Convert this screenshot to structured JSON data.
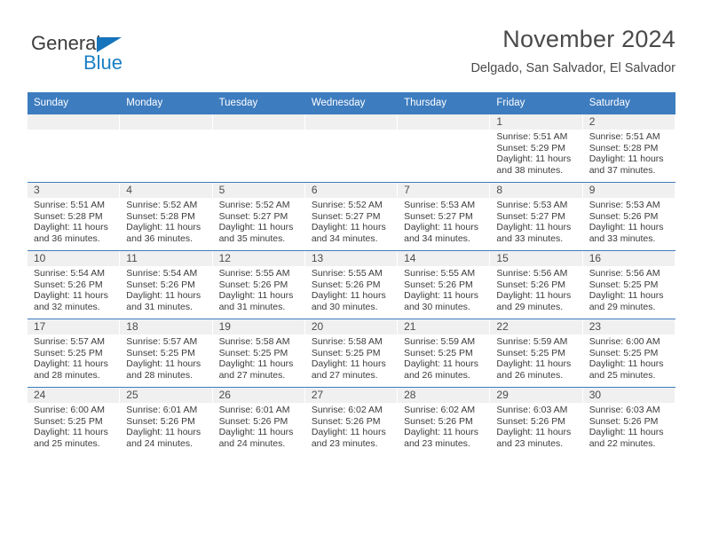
{
  "logo": {
    "word_top": "General",
    "word_bottom": "Blue",
    "triangle_color": "#1574bb",
    "blue_color": "#1b7fc4"
  },
  "header": {
    "title": "November 2024",
    "subtitle": "Delgado, San Salvador, El Salvador"
  },
  "theme": {
    "header_row_bg": "#3d7cbf",
    "cell_band_bg": "#f0f0f0",
    "text_color": "#3c3c3c"
  },
  "weekday_headers": [
    "Sunday",
    "Monday",
    "Tuesday",
    "Wednesday",
    "Thursday",
    "Friday",
    "Saturday"
  ],
  "weeks": [
    [
      {
        "day": "",
        "sunrise": "",
        "sunset": "",
        "daylight_1": "",
        "daylight_2": ""
      },
      {
        "day": "",
        "sunrise": "",
        "sunset": "",
        "daylight_1": "",
        "daylight_2": ""
      },
      {
        "day": "",
        "sunrise": "",
        "sunset": "",
        "daylight_1": "",
        "daylight_2": ""
      },
      {
        "day": "",
        "sunrise": "",
        "sunset": "",
        "daylight_1": "",
        "daylight_2": ""
      },
      {
        "day": "",
        "sunrise": "",
        "sunset": "",
        "daylight_1": "",
        "daylight_2": ""
      },
      {
        "day": "1",
        "sunrise": "Sunrise: 5:51 AM",
        "sunset": "Sunset: 5:29 PM",
        "daylight_1": "Daylight: 11 hours",
        "daylight_2": "and 38 minutes."
      },
      {
        "day": "2",
        "sunrise": "Sunrise: 5:51 AM",
        "sunset": "Sunset: 5:28 PM",
        "daylight_1": "Daylight: 11 hours",
        "daylight_2": "and 37 minutes."
      }
    ],
    [
      {
        "day": "3",
        "sunrise": "Sunrise: 5:51 AM",
        "sunset": "Sunset: 5:28 PM",
        "daylight_1": "Daylight: 11 hours",
        "daylight_2": "and 36 minutes."
      },
      {
        "day": "4",
        "sunrise": "Sunrise: 5:52 AM",
        "sunset": "Sunset: 5:28 PM",
        "daylight_1": "Daylight: 11 hours",
        "daylight_2": "and 36 minutes."
      },
      {
        "day": "5",
        "sunrise": "Sunrise: 5:52 AM",
        "sunset": "Sunset: 5:27 PM",
        "daylight_1": "Daylight: 11 hours",
        "daylight_2": "and 35 minutes."
      },
      {
        "day": "6",
        "sunrise": "Sunrise: 5:52 AM",
        "sunset": "Sunset: 5:27 PM",
        "daylight_1": "Daylight: 11 hours",
        "daylight_2": "and 34 minutes."
      },
      {
        "day": "7",
        "sunrise": "Sunrise: 5:53 AM",
        "sunset": "Sunset: 5:27 PM",
        "daylight_1": "Daylight: 11 hours",
        "daylight_2": "and 34 minutes."
      },
      {
        "day": "8",
        "sunrise": "Sunrise: 5:53 AM",
        "sunset": "Sunset: 5:27 PM",
        "daylight_1": "Daylight: 11 hours",
        "daylight_2": "and 33 minutes."
      },
      {
        "day": "9",
        "sunrise": "Sunrise: 5:53 AM",
        "sunset": "Sunset: 5:26 PM",
        "daylight_1": "Daylight: 11 hours",
        "daylight_2": "and 33 minutes."
      }
    ],
    [
      {
        "day": "10",
        "sunrise": "Sunrise: 5:54 AM",
        "sunset": "Sunset: 5:26 PM",
        "daylight_1": "Daylight: 11 hours",
        "daylight_2": "and 32 minutes."
      },
      {
        "day": "11",
        "sunrise": "Sunrise: 5:54 AM",
        "sunset": "Sunset: 5:26 PM",
        "daylight_1": "Daylight: 11 hours",
        "daylight_2": "and 31 minutes."
      },
      {
        "day": "12",
        "sunrise": "Sunrise: 5:55 AM",
        "sunset": "Sunset: 5:26 PM",
        "daylight_1": "Daylight: 11 hours",
        "daylight_2": "and 31 minutes."
      },
      {
        "day": "13",
        "sunrise": "Sunrise: 5:55 AM",
        "sunset": "Sunset: 5:26 PM",
        "daylight_1": "Daylight: 11 hours",
        "daylight_2": "and 30 minutes."
      },
      {
        "day": "14",
        "sunrise": "Sunrise: 5:55 AM",
        "sunset": "Sunset: 5:26 PM",
        "daylight_1": "Daylight: 11 hours",
        "daylight_2": "and 30 minutes."
      },
      {
        "day": "15",
        "sunrise": "Sunrise: 5:56 AM",
        "sunset": "Sunset: 5:26 PM",
        "daylight_1": "Daylight: 11 hours",
        "daylight_2": "and 29 minutes."
      },
      {
        "day": "16",
        "sunrise": "Sunrise: 5:56 AM",
        "sunset": "Sunset: 5:25 PM",
        "daylight_1": "Daylight: 11 hours",
        "daylight_2": "and 29 minutes."
      }
    ],
    [
      {
        "day": "17",
        "sunrise": "Sunrise: 5:57 AM",
        "sunset": "Sunset: 5:25 PM",
        "daylight_1": "Daylight: 11 hours",
        "daylight_2": "and 28 minutes."
      },
      {
        "day": "18",
        "sunrise": "Sunrise: 5:57 AM",
        "sunset": "Sunset: 5:25 PM",
        "daylight_1": "Daylight: 11 hours",
        "daylight_2": "and 28 minutes."
      },
      {
        "day": "19",
        "sunrise": "Sunrise: 5:58 AM",
        "sunset": "Sunset: 5:25 PM",
        "daylight_1": "Daylight: 11 hours",
        "daylight_2": "and 27 minutes."
      },
      {
        "day": "20",
        "sunrise": "Sunrise: 5:58 AM",
        "sunset": "Sunset: 5:25 PM",
        "daylight_1": "Daylight: 11 hours",
        "daylight_2": "and 27 minutes."
      },
      {
        "day": "21",
        "sunrise": "Sunrise: 5:59 AM",
        "sunset": "Sunset: 5:25 PM",
        "daylight_1": "Daylight: 11 hours",
        "daylight_2": "and 26 minutes."
      },
      {
        "day": "22",
        "sunrise": "Sunrise: 5:59 AM",
        "sunset": "Sunset: 5:25 PM",
        "daylight_1": "Daylight: 11 hours",
        "daylight_2": "and 26 minutes."
      },
      {
        "day": "23",
        "sunrise": "Sunrise: 6:00 AM",
        "sunset": "Sunset: 5:25 PM",
        "daylight_1": "Daylight: 11 hours",
        "daylight_2": "and 25 minutes."
      }
    ],
    [
      {
        "day": "24",
        "sunrise": "Sunrise: 6:00 AM",
        "sunset": "Sunset: 5:25 PM",
        "daylight_1": "Daylight: 11 hours",
        "daylight_2": "and 25 minutes."
      },
      {
        "day": "25",
        "sunrise": "Sunrise: 6:01 AM",
        "sunset": "Sunset: 5:26 PM",
        "daylight_1": "Daylight: 11 hours",
        "daylight_2": "and 24 minutes."
      },
      {
        "day": "26",
        "sunrise": "Sunrise: 6:01 AM",
        "sunset": "Sunset: 5:26 PM",
        "daylight_1": "Daylight: 11 hours",
        "daylight_2": "and 24 minutes."
      },
      {
        "day": "27",
        "sunrise": "Sunrise: 6:02 AM",
        "sunset": "Sunset: 5:26 PM",
        "daylight_1": "Daylight: 11 hours",
        "daylight_2": "and 23 minutes."
      },
      {
        "day": "28",
        "sunrise": "Sunrise: 6:02 AM",
        "sunset": "Sunset: 5:26 PM",
        "daylight_1": "Daylight: 11 hours",
        "daylight_2": "and 23 minutes."
      },
      {
        "day": "29",
        "sunrise": "Sunrise: 6:03 AM",
        "sunset": "Sunset: 5:26 PM",
        "daylight_1": "Daylight: 11 hours",
        "daylight_2": "and 23 minutes."
      },
      {
        "day": "30",
        "sunrise": "Sunrise: 6:03 AM",
        "sunset": "Sunset: 5:26 PM",
        "daylight_1": "Daylight: 11 hours",
        "daylight_2": "and 22 minutes."
      }
    ]
  ]
}
